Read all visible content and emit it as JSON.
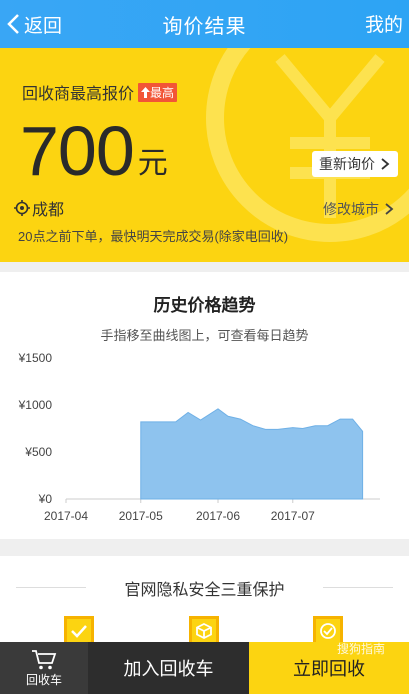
{
  "header": {
    "back_label": "返回",
    "title": "询价结果",
    "mine_label": "我的",
    "bg_color": "#39a6f5"
  },
  "hero": {
    "label": "回收商最高报价",
    "badge": "最高",
    "price": "700",
    "unit": "元",
    "reinquire_label": "重新询价",
    "city": "成都",
    "change_city_label": "修改城市",
    "notice": "20点之前下单，最快明天完成交易(除家电回收)",
    "bg_color": "#fcd411"
  },
  "trend": {
    "title": "历史价格趋势",
    "subtitle": "手指移至曲线图上，可查看每日趋势"
  },
  "chart_data": {
    "type": "area",
    "title": "历史价格趋势",
    "xlabel": "",
    "ylabel": "",
    "ylim": [
      0,
      1500
    ],
    "yticks": [
      "¥1500",
      "¥1000",
      "¥500",
      "¥0"
    ],
    "xticks": [
      "2017-04",
      "2017-05",
      "2017-06",
      "2017-07"
    ],
    "series": [
      {
        "x": [
          "2017-05-01",
          "2017-05-10",
          "2017-05-15",
          "2017-05-20",
          "2017-05-25",
          "2017-06-01",
          "2017-06-05",
          "2017-06-10",
          "2017-06-15",
          "2017-06-20",
          "2017-06-25",
          "2017-07-01",
          "2017-07-05",
          "2017-07-10",
          "2017-07-15",
          "2017-07-20",
          "2017-07-25",
          "2017-07-29"
        ],
        "values": [
          820,
          820,
          820,
          920,
          840,
          960,
          880,
          850,
          780,
          740,
          740,
          760,
          750,
          780,
          780,
          850,
          850,
          720
        ]
      }
    ],
    "fill_color": "#8ec3ee",
    "grid": false
  },
  "guarantee": {
    "title": "官网隐私安全三重保护"
  },
  "bottom": {
    "cart_label": "回收车",
    "add_label": "加入回收车",
    "recycle_label": "立即回收"
  },
  "watermark": "搜狗指南"
}
